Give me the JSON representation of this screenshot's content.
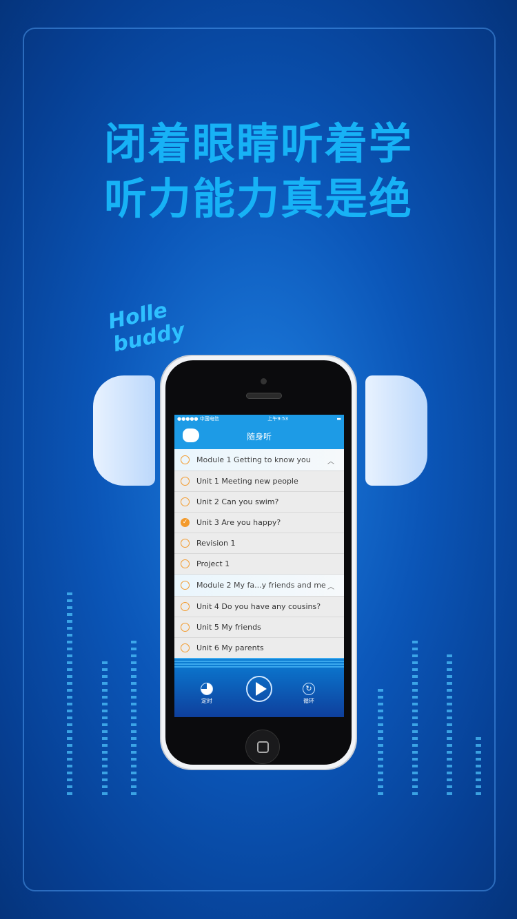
{
  "promo": {
    "line1": "闭着眼睛听着学",
    "line2": "听力能力真是绝",
    "sticker_line1": "Holle",
    "sticker_line2": "buddy"
  },
  "status_bar": {
    "carrier": "●●●●● 中国电信",
    "time": "上午9:53",
    "battery_icon": "battery-icon"
  },
  "nav": {
    "title": "随身听",
    "back_icon": "back-icon"
  },
  "list": [
    {
      "type": "module",
      "label": "Module 1  Getting to know you",
      "expanded": true,
      "checked": false
    },
    {
      "type": "unit",
      "label": "Unit 1  Meeting new people",
      "checked": false
    },
    {
      "type": "unit",
      "label": "Unit 2  Can you swim?",
      "checked": false
    },
    {
      "type": "unit",
      "label": "Unit 3  Are you happy?",
      "checked": true
    },
    {
      "type": "unit",
      "label": "Revision 1",
      "checked": false
    },
    {
      "type": "unit",
      "label": "Project 1",
      "checked": false
    },
    {
      "type": "module",
      "label": "Module 2  My fa...y friends and me",
      "expanded": true,
      "checked": false
    },
    {
      "type": "unit",
      "label": "Unit 4  Do you have any cousins?",
      "checked": false
    },
    {
      "type": "unit",
      "label": "Unit 5  My friends",
      "checked": false
    },
    {
      "type": "unit",
      "label": "Unit 6  My parents",
      "checked": false
    }
  ],
  "player": {
    "timer_label": "定时",
    "loop_label": "循环",
    "play_icon": "play-icon"
  },
  "colors": {
    "accent": "#1d9be6",
    "check": "#f39a2c",
    "headline": "#17b2f6"
  }
}
